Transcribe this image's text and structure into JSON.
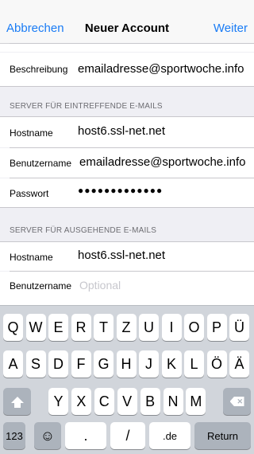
{
  "nav": {
    "cancel": "Abbrechen",
    "title": "Neuer Account",
    "next": "Weiter"
  },
  "rows": {
    "description": {
      "label": "Beschreibung",
      "value": "emailadresse@sportwoche.info"
    }
  },
  "incoming": {
    "header": "SERVER FÜR EINTREFFENDE E-MAILS",
    "hostname": {
      "label": "Hostname",
      "value": "host6.ssl-net.net"
    },
    "username": {
      "label": "Benutzername",
      "value": "emailadresse@sportwoche.info"
    },
    "password": {
      "label": "Passwort",
      "value": "●●●●●●●●●●●●●"
    }
  },
  "outgoing": {
    "header": "SERVER FÜR AUSGEHENDE E-MAILS",
    "hostname": {
      "label": "Hostname",
      "value": "host6.ssl-net.net"
    },
    "username": {
      "label": "Benutzername",
      "placeholder": "Optional"
    }
  },
  "keyboard": {
    "row1": [
      "Q",
      "W",
      "E",
      "R",
      "T",
      "Z",
      "U",
      "I",
      "O",
      "P",
      "Ü"
    ],
    "row2": [
      "A",
      "S",
      "D",
      "F",
      "G",
      "H",
      "J",
      "K",
      "L",
      "Ö",
      "Ä"
    ],
    "row3": [
      "Y",
      "X",
      "C",
      "V",
      "B",
      "N",
      "M"
    ],
    "numbers": "123",
    "period": ".",
    "slash": "/",
    "domain": ".de",
    "return": "Return"
  },
  "colors": {
    "accent": "#1a7cf5",
    "background": "#efeff4",
    "keyboard": "#d1d5db"
  }
}
